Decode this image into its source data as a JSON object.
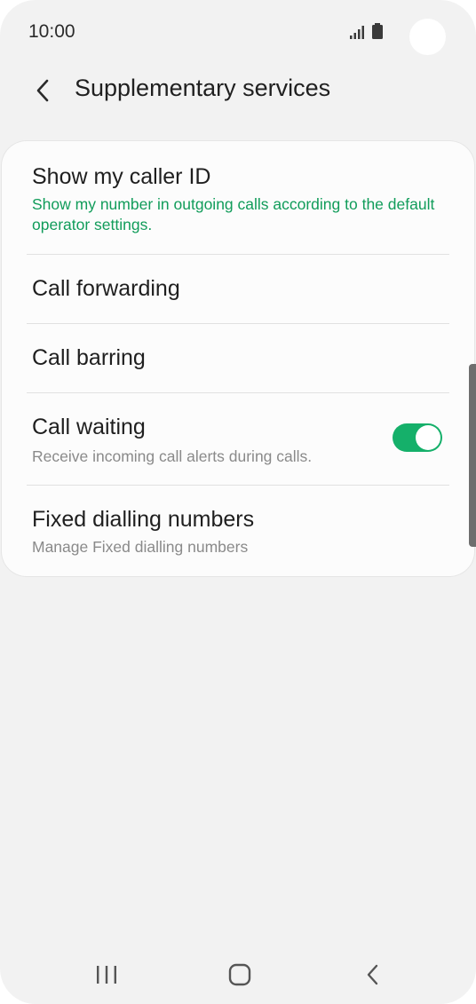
{
  "status_bar": {
    "time": "10:00"
  },
  "header": {
    "title": "Supplementary services",
    "back_icon": "chevron-left-icon"
  },
  "items": [
    {
      "title": "Show my caller ID",
      "subtitle": "Show my number in outgoing calls according to the default operator settings."
    },
    {
      "title": "Call forwarding"
    },
    {
      "title": "Call barring"
    },
    {
      "title": "Call waiting",
      "subtitle": "Receive incoming call alerts during calls.",
      "toggle_on": true
    },
    {
      "title": "Fixed dialling numbers",
      "subtitle": "Manage Fixed dialling numbers"
    }
  ],
  "navbar": {
    "recents_icon": "recents-icon",
    "home_icon": "home-icon",
    "back_icon": "back-icon"
  },
  "colors": {
    "accent": "#15b06a",
    "accent_text": "#119c5a",
    "background": "#f2f2f2",
    "card": "#fcfcfc"
  }
}
